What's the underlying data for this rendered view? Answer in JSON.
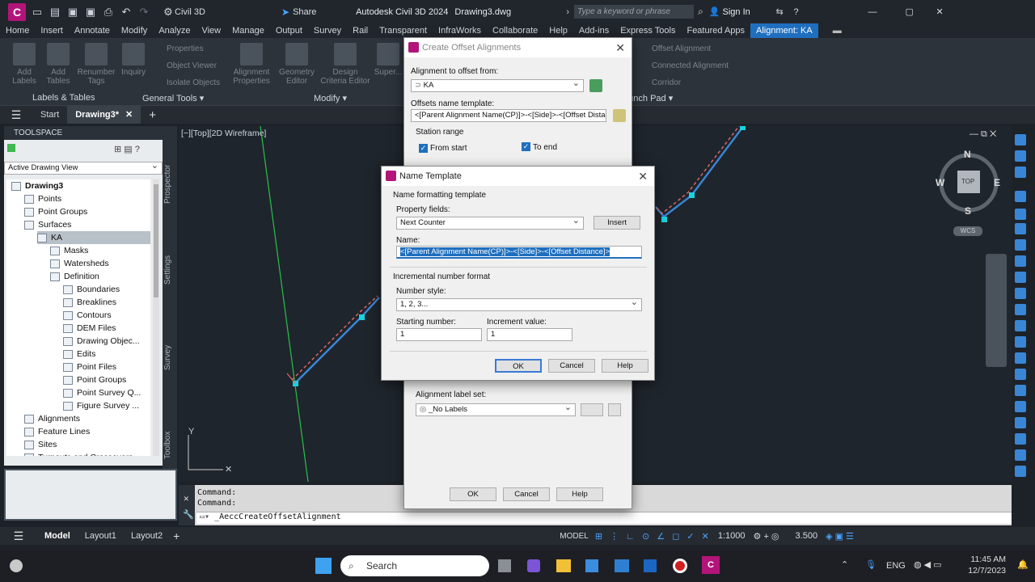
{
  "titlebar": {
    "workspace": "Civil 3D",
    "share": "Share",
    "title": "Autodesk Civil 3D 2024",
    "file": "Drawing3.dwg",
    "search_placeholder": "Type a keyword or phrase",
    "sign_in": "Sign In"
  },
  "ribbon_tabs": [
    "Home",
    "Insert",
    "Annotate",
    "Modify",
    "Analyze",
    "View",
    "Manage",
    "Output",
    "Survey",
    "Rail",
    "Transparent",
    "InfraWorks",
    "Collaborate",
    "Help",
    "Add-ins",
    "Express Tools",
    "Featured Apps",
    "Alignment: KA"
  ],
  "ribbon": {
    "buttons": [
      "Add Labels",
      "Add Tables",
      "Renumber Tags",
      "Inquiry",
      "Properties",
      "Object Viewer",
      "Isolate Objects",
      "Alignment Properties",
      "Geometry Editor",
      "Design Criteria Editor",
      "Super...",
      "Offset Alignment",
      "Connected Alignment",
      "Corridor"
    ],
    "groups": [
      "Labels & Tables",
      "General Tools ▾",
      "Modify ▾",
      "...unch Pad ▾"
    ]
  },
  "doc_tabs": {
    "start": "Start",
    "drawing": "Drawing3*"
  },
  "toolspace": {
    "title": "TOOLSPACE",
    "view": "Active Drawing View",
    "side_tabs": [
      "Prospector",
      "Settings",
      "Survey",
      "Toolbox"
    ],
    "tree": [
      {
        "label": "Drawing3",
        "level": 0,
        "bold": true
      },
      {
        "label": "Points",
        "level": 1
      },
      {
        "label": "Point Groups",
        "level": 1
      },
      {
        "label": "Surfaces",
        "level": 1
      },
      {
        "label": "KA",
        "level": 2,
        "selected": true
      },
      {
        "label": "Masks",
        "level": 3
      },
      {
        "label": "Watersheds",
        "level": 3
      },
      {
        "label": "Definition",
        "level": 3
      },
      {
        "label": "Boundaries",
        "level": 4
      },
      {
        "label": "Breaklines",
        "level": 4
      },
      {
        "label": "Contours",
        "level": 4
      },
      {
        "label": "DEM Files",
        "level": 4
      },
      {
        "label": "Drawing Objec...",
        "level": 4
      },
      {
        "label": "Edits",
        "level": 4
      },
      {
        "label": "Point Files",
        "level": 4
      },
      {
        "label": "Point Groups",
        "level": 4
      },
      {
        "label": "Point Survey Q...",
        "level": 4
      },
      {
        "label": "Figure Survey ...",
        "level": 4
      },
      {
        "label": "Alignments",
        "level": 1
      },
      {
        "label": "Feature Lines",
        "level": 1
      },
      {
        "label": "Sites",
        "level": 1
      },
      {
        "label": "Turnouts and Crossovers",
        "level": 1
      }
    ]
  },
  "viewport": {
    "label": "[−][Top][2D Wireframe]",
    "compass": {
      "n": "N",
      "s": "S",
      "e": "E",
      "w": "W",
      "top": "TOP",
      "wcs": "WCS"
    },
    "ucs_y": "Y"
  },
  "command": {
    "line1": "Command:",
    "line2": "Command:",
    "input": "_AeccCreateOffsetAlignment"
  },
  "status": {
    "tabs": [
      "Model",
      "Layout1",
      "Layout2"
    ],
    "model": "MODEL",
    "scale": "1:1000",
    "value": "3.500"
  },
  "offset_dialog": {
    "title": "Create Offset Alignments",
    "alignment_label": "Alignment to offset from:",
    "alignment_value": "KA",
    "template_label": "Offsets name template:",
    "template_value": "<[Parent Alignment Name(CP)]>-<[Side]>-<[Offset Distance",
    "station_range": "Station range",
    "from_start": "From start",
    "to_end": "To end",
    "label_set_label": "Alignment label set:",
    "label_set_value": "_No Labels",
    "ok": "OK",
    "cancel": "Cancel",
    "help": "Help"
  },
  "name_dialog": {
    "title": "Name Template",
    "section1": "Name formatting template",
    "property_fields_label": "Property fields:",
    "property_fields_value": "Next Counter",
    "insert": "Insert",
    "name_label": "Name:",
    "name_value": "<[Parent Alignment Name(CP)]>-<[Side]>-<[Offset Distance]>",
    "section2": "Incremental number format",
    "number_style_label": "Number style:",
    "number_style_value": "1, 2, 3...",
    "starting_label": "Starting number:",
    "starting_value": "1",
    "increment_label": "Increment value:",
    "increment_value": "1",
    "ok": "OK",
    "cancel": "Cancel",
    "help": "Help"
  },
  "taskbar": {
    "search": "Search",
    "lang": "ENG",
    "time": "11:45 AM",
    "date": "12/7/2023"
  },
  "colors": {
    "accent": "#1f6fbf",
    "brand": "#b3147a",
    "alignment": "#3a86d6",
    "offset": "#e06a6a",
    "axis": "#27c24a",
    "node": "#19d3e0"
  }
}
